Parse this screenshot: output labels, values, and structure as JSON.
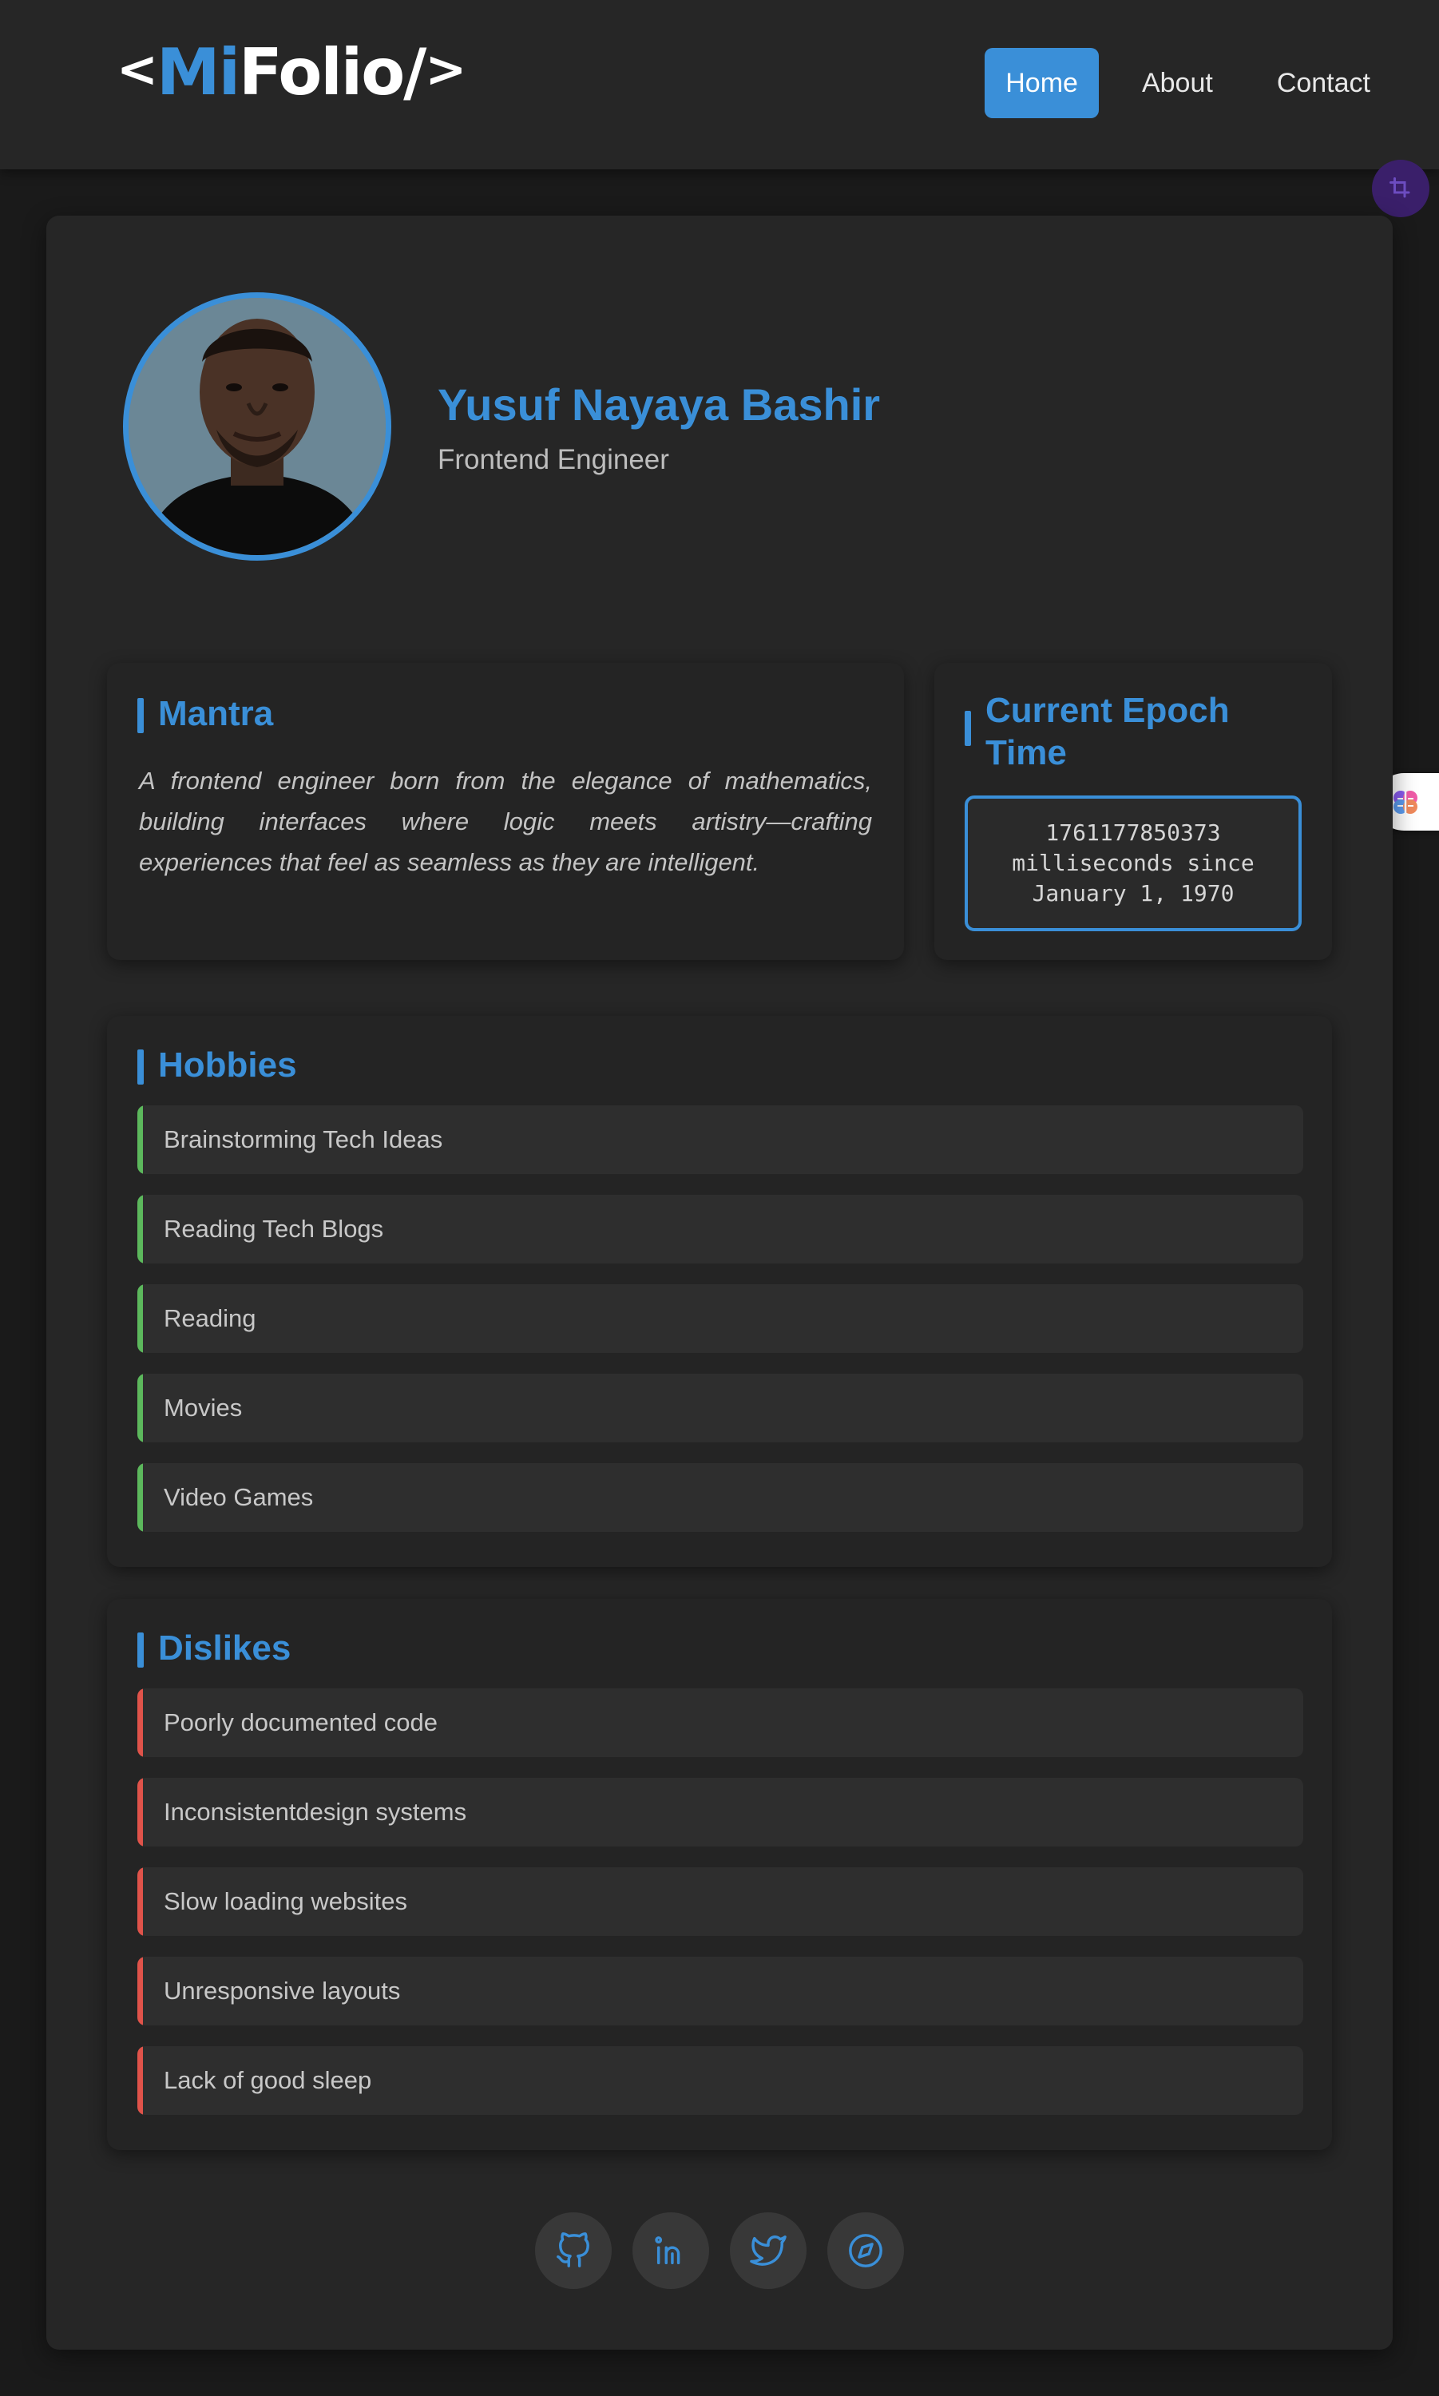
{
  "header": {
    "logo": {
      "open": "<",
      "accent": "Mi",
      "rest": "Folio/",
      "close": ">"
    },
    "nav": [
      {
        "label": "Home",
        "active": true
      },
      {
        "label": "About",
        "active": false
      },
      {
        "label": "Contact",
        "active": false
      }
    ]
  },
  "profile": {
    "name": "Yusuf Nayaya Bashir",
    "role": "Frontend Engineer"
  },
  "mantra": {
    "title": "Mantra",
    "text": "A frontend engineer born from the elegance of mathematics, building interfaces where logic meets artistry—crafting experiences that feel as seamless as they are intelligent."
  },
  "epoch": {
    "title": "Current Epoch Time",
    "value": "1761177850373",
    "caption": "milliseconds since January 1, 1970"
  },
  "hobbies": {
    "title": "Hobbies",
    "items": [
      "Brainstorming Tech Ideas",
      "Reading Tech Blogs",
      "Reading",
      "Movies",
      "Video Games"
    ]
  },
  "dislikes": {
    "title": "Dislikes",
    "items": [
      "Poorly documented code",
      "Inconsistentdesign systems",
      "Slow loading websites",
      "Unresponsive layouts",
      "Lack of good sleep"
    ]
  },
  "socials": [
    {
      "icon": "github-icon"
    },
    {
      "icon": "linkedin-icon"
    },
    {
      "icon": "twitter-icon"
    },
    {
      "icon": "compass-icon"
    }
  ],
  "colors": {
    "accent": "#3a8fd8",
    "background": "#1a1a1a",
    "card": "#262626",
    "hobby_marker": "#5cb85c",
    "dislike_marker": "#e0534a"
  }
}
